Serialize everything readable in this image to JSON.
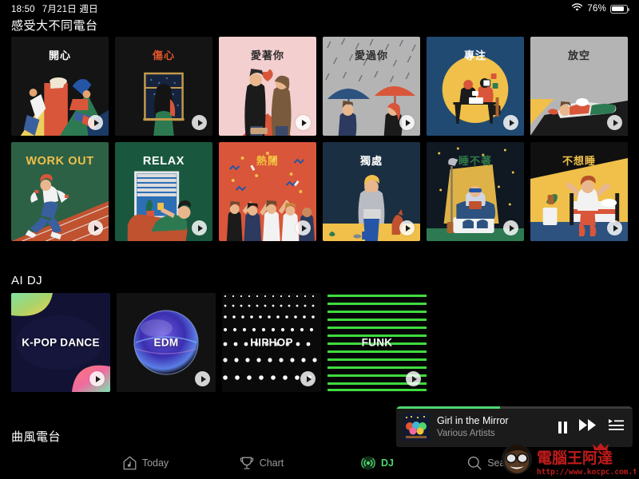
{
  "statusbar": {
    "time": "18:50",
    "date": "7月21日 週日",
    "battery_percent": "76%",
    "wifi_icon": "wifi-icon",
    "battery_icon": "battery-icon"
  },
  "sections": {
    "mood": {
      "title": "感受大不同電台"
    },
    "aidj": {
      "title": "AI DJ"
    },
    "genre": {
      "title": "曲風電台"
    }
  },
  "mood_cards": [
    {
      "label": "開心",
      "text_color": "#ffffff",
      "bg": "#141414"
    },
    {
      "label": "傷心",
      "text_color": "#e0552b",
      "bg": "#141414"
    },
    {
      "label": "愛著你",
      "text_color": "#2b2b2b",
      "bg": "#f3cfcf"
    },
    {
      "label": "愛過你",
      "text_color": "#2b2b2b",
      "bg": "#b4b4b4"
    },
    {
      "label": "專注",
      "text_color": "#ffffff",
      "bg": "#214a72"
    },
    {
      "label": "放空",
      "text_color": "#2b2b2b",
      "bg": "#b4b4b4"
    },
    {
      "label": "WORK OUT",
      "text_color": "#f0c04a",
      "bg": "#2d6145"
    },
    {
      "label": "RELAX",
      "text_color": "#ffffff",
      "bg": "#19583f"
    },
    {
      "label": "熱鬧",
      "text_color": "#f2c23c",
      "bg": "#d9563a"
    },
    {
      "label": "獨處",
      "text_color": "#ffffff",
      "bg": "#1b2f42"
    },
    {
      "label": "睡不著",
      "text_color": "#2f7a4a",
      "bg": "#101822"
    },
    {
      "label": "不想睡",
      "text_color": "#f0c04a",
      "bg": "#101010"
    }
  ],
  "aidj_cards": [
    {
      "label": "K-POP DANCE",
      "style": "kpop"
    },
    {
      "label": "EDM",
      "style": "edm"
    },
    {
      "label": "HIPHOP",
      "style": "hiphop"
    },
    {
      "label": "FUNK",
      "style": "funk"
    }
  ],
  "now_playing": {
    "title": "Girl in the Mirror",
    "artist": "Various Artists",
    "progress_percent": 44,
    "progress_color": "#4fd66f",
    "pause_icon": "pause-icon",
    "next_icon": "next-track-icon",
    "queue_icon": "queue-list-icon",
    "album_art": "album-art-thumbnail"
  },
  "tabs": [
    {
      "label": "Today",
      "icon": "today-house-note-icon",
      "active": false
    },
    {
      "label": "Chart",
      "icon": "trophy-icon",
      "active": false
    },
    {
      "label": "DJ",
      "icon": "dj-broadcast-icon",
      "active": true
    },
    {
      "label": "Search",
      "icon": "search-icon",
      "active": false
    }
  ],
  "watermark": {
    "brand": "電腦王阿達",
    "url": "http://www.kocpc.com.tw"
  },
  "colors": {
    "accent": "#4fd66f",
    "background": "#000000",
    "panel": "#1b1b1b"
  }
}
